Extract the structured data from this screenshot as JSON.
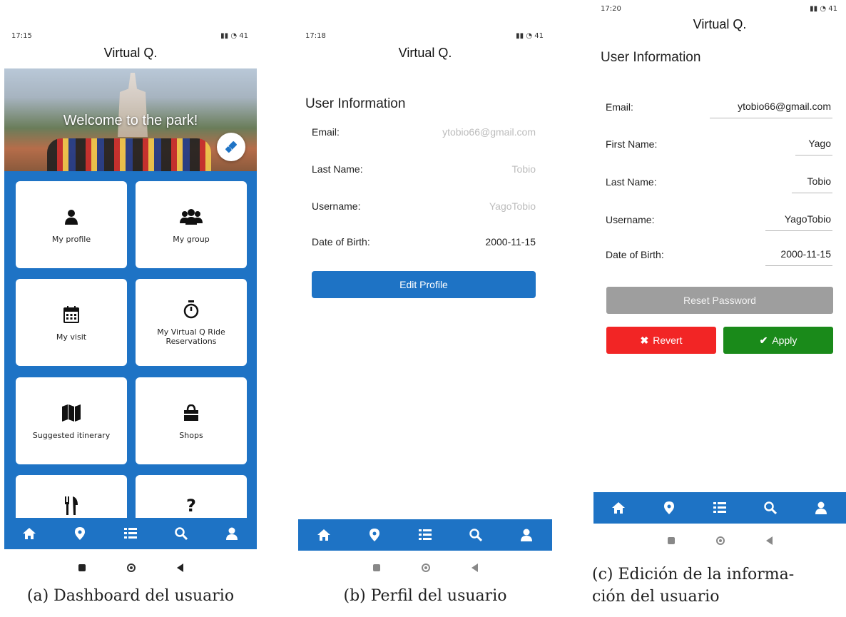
{
  "panel_a": {
    "status_time": "17:15",
    "status_battery": "41",
    "app_title": "Virtual Q.",
    "hero_text": "Welcome to the park!",
    "tiles": [
      {
        "label": "My profile",
        "icon": "user-icon"
      },
      {
        "label": "My group",
        "icon": "users-icon"
      },
      {
        "label": "My visit",
        "icon": "calendar-icon"
      },
      {
        "label": "My Virtual Q Ride Reservations",
        "icon": "stopwatch-icon"
      },
      {
        "label": "Suggested itinerary",
        "icon": "map-icon"
      },
      {
        "label": "Shops",
        "icon": "shopping-bag-icon"
      },
      {
        "label": "",
        "icon": "utensils-icon"
      },
      {
        "label": "",
        "icon": "question-icon"
      }
    ],
    "fab_icon": "ticket-icon",
    "caption": "(a) Dashboard del usuario"
  },
  "panel_b": {
    "status_time": "17:18",
    "status_battery": "41",
    "app_title": "Virtual Q.",
    "section_title": "User Information",
    "fields": [
      {
        "label": "Email:",
        "value": "ytobio66@gmail.com"
      },
      {
        "label": "Last Name:",
        "value": "Tobio"
      },
      {
        "label": "Username:",
        "value": "YagoTobio"
      },
      {
        "label": "Date of Birth:",
        "value": "2000-11-15"
      }
    ],
    "edit_button": "Edit Profile",
    "caption": "(b) Perfil del usuario"
  },
  "panel_c": {
    "status_time": "17:20",
    "status_battery": "41",
    "app_title": "Virtual Q.",
    "section_title": "User Information",
    "fields": [
      {
        "label": "Email:",
        "value": "ytobio66@gmail.com"
      },
      {
        "label": "First Name:",
        "value": "Yago"
      },
      {
        "label": "Last Name:",
        "value": "Tobio"
      },
      {
        "label": "Username:",
        "value": "YagoTobio"
      },
      {
        "label": "Date of Birth:",
        "value": "2000-11-15"
      }
    ],
    "reset_button": "Reset Password",
    "revert_button": "Revert",
    "apply_button": "Apply",
    "caption_line1": "(c) Edición de la informa-",
    "caption_line2": "ción del usuario"
  },
  "bottom_nav": [
    "home-icon",
    "map-marker-icon",
    "list-icon",
    "search-icon",
    "user-icon"
  ],
  "colors": {
    "primary": "#1e73c5",
    "revert": "#f22525",
    "apply": "#1a8a1a",
    "reset": "#9e9e9e"
  }
}
